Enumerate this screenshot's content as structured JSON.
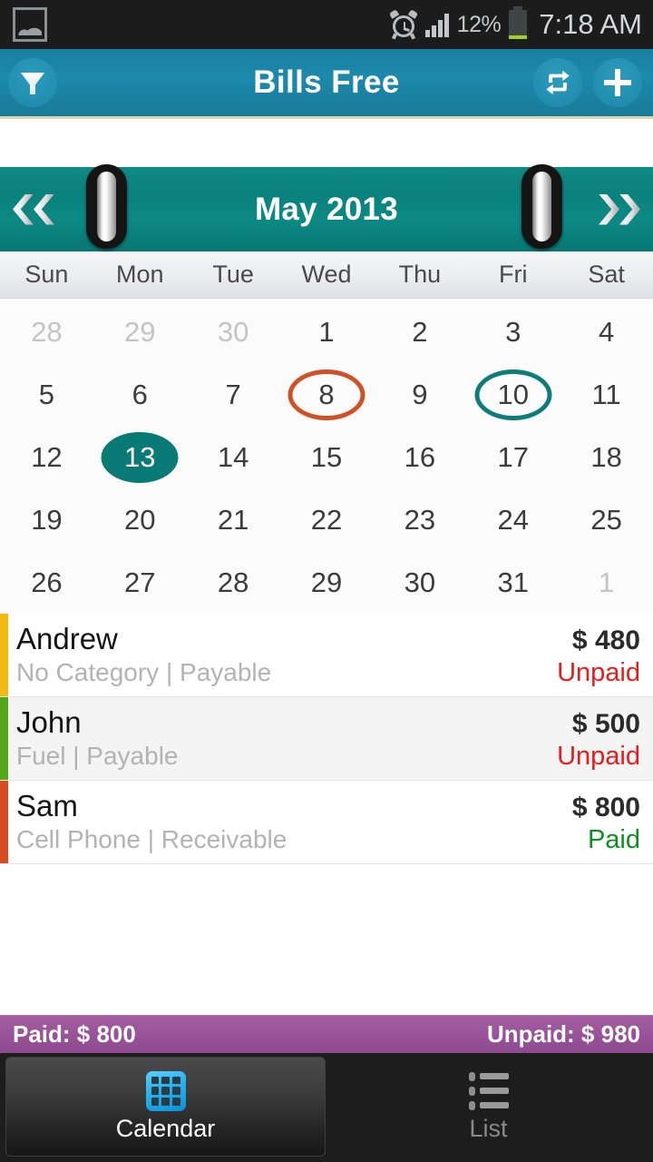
{
  "status_bar": {
    "gallery_icon": "gallery-icon",
    "alarm_icon": "alarm-clock-icon",
    "signal_icon": "signal-bars-icon",
    "battery_percent": "12%",
    "battery_icon": "battery-icon",
    "time": "7:18 AM"
  },
  "app_bar": {
    "title": "Bills Free",
    "filter_icon": "filter-funnel-icon",
    "repeat_icon": "repeat-icon",
    "add_icon": "plus-icon"
  },
  "calendar": {
    "prev_label": "«",
    "next_label": "»",
    "month_title": "May 2013",
    "weekdays": [
      "Sun",
      "Mon",
      "Tue",
      "Wed",
      "Thu",
      "Fri",
      "Sat"
    ],
    "weeks": [
      [
        {
          "n": "28",
          "muted": true,
          "mark": "none"
        },
        {
          "n": "29",
          "muted": true,
          "mark": "none"
        },
        {
          "n": "30",
          "muted": true,
          "mark": "none"
        },
        {
          "n": "1",
          "muted": false,
          "mark": "none"
        },
        {
          "n": "2",
          "muted": false,
          "mark": "none"
        },
        {
          "n": "3",
          "muted": false,
          "mark": "none"
        },
        {
          "n": "4",
          "muted": false,
          "mark": "none"
        }
      ],
      [
        {
          "n": "5",
          "muted": false,
          "mark": "none"
        },
        {
          "n": "6",
          "muted": false,
          "mark": "none"
        },
        {
          "n": "7",
          "muted": false,
          "mark": "none"
        },
        {
          "n": "8",
          "muted": false,
          "mark": "ring-red"
        },
        {
          "n": "9",
          "muted": false,
          "mark": "none"
        },
        {
          "n": "10",
          "muted": false,
          "mark": "ring-teal"
        },
        {
          "n": "11",
          "muted": false,
          "mark": "none"
        }
      ],
      [
        {
          "n": "12",
          "muted": false,
          "mark": "none"
        },
        {
          "n": "13",
          "muted": false,
          "mark": "fill-teal"
        },
        {
          "n": "14",
          "muted": false,
          "mark": "none"
        },
        {
          "n": "15",
          "muted": false,
          "mark": "none"
        },
        {
          "n": "16",
          "muted": false,
          "mark": "none"
        },
        {
          "n": "17",
          "muted": false,
          "mark": "none"
        },
        {
          "n": "18",
          "muted": false,
          "mark": "none"
        }
      ],
      [
        {
          "n": "19",
          "muted": false,
          "mark": "none"
        },
        {
          "n": "20",
          "muted": false,
          "mark": "none"
        },
        {
          "n": "21",
          "muted": false,
          "mark": "none"
        },
        {
          "n": "22",
          "muted": false,
          "mark": "none"
        },
        {
          "n": "23",
          "muted": false,
          "mark": "none"
        },
        {
          "n": "24",
          "muted": false,
          "mark": "none"
        },
        {
          "n": "25",
          "muted": false,
          "mark": "none"
        }
      ],
      [
        {
          "n": "26",
          "muted": false,
          "mark": "none"
        },
        {
          "n": "27",
          "muted": false,
          "mark": "none"
        },
        {
          "n": "28",
          "muted": false,
          "mark": "none"
        },
        {
          "n": "29",
          "muted": false,
          "mark": "none"
        },
        {
          "n": "30",
          "muted": false,
          "mark": "none"
        },
        {
          "n": "31",
          "muted": false,
          "mark": "none"
        },
        {
          "n": "1",
          "muted": true,
          "mark": "none"
        }
      ]
    ]
  },
  "transactions": [
    {
      "name": "Andrew",
      "meta": "No Category | Payable",
      "amount": "$ 480",
      "status": "Unpaid",
      "status_kind": "unpaid",
      "accent_color": "#F5B914",
      "alt_row": false
    },
    {
      "name": "John",
      "meta": "Fuel | Payable",
      "amount": "$ 500",
      "status": "Unpaid",
      "status_kind": "unpaid",
      "accent_color": "#55A81A",
      "alt_row": true
    },
    {
      "name": "Sam",
      "meta": "Cell Phone | Receivable",
      "amount": "$ 800",
      "status": "Paid",
      "status_kind": "paid",
      "accent_color": "#D94A1E",
      "alt_row": false
    }
  ],
  "summary": {
    "paid": "Paid: $ 800",
    "unpaid": "Unpaid: $ 980"
  },
  "tabs": [
    {
      "label": "Calendar",
      "icon": "calendar-grid-icon",
      "active": true
    },
    {
      "label": "List",
      "icon": "bullet-list-icon",
      "active": false
    }
  ],
  "colors": {
    "app_bar": "#1c89ab",
    "month_bar": "#0a817c",
    "accent_teal": "#0a7a76",
    "ring_red": "#cf5128",
    "unpaid": "#e81c1c",
    "paid": "#0e8f22",
    "summary_bar": "#9a549a"
  }
}
